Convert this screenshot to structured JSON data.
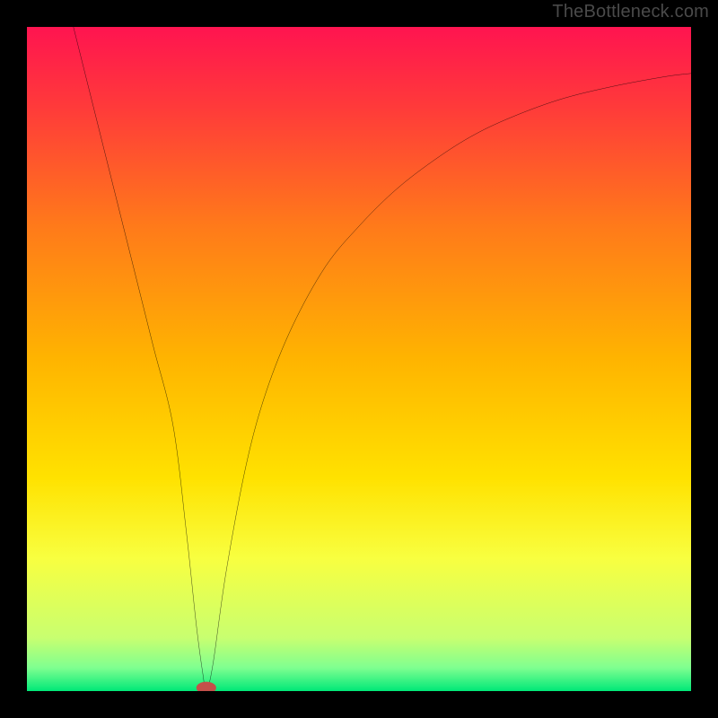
{
  "watermark": "TheBottleneck.com",
  "chart_data": {
    "type": "line",
    "title": "",
    "xlabel": "",
    "ylabel": "",
    "xlim": [
      0,
      100
    ],
    "ylim": [
      0,
      100
    ],
    "gradient_stops": [
      {
        "offset": 0.0,
        "color": "#ff1450"
      },
      {
        "offset": 0.12,
        "color": "#ff3a3a"
      },
      {
        "offset": 0.3,
        "color": "#ff7a1a"
      },
      {
        "offset": 0.5,
        "color": "#ffb400"
      },
      {
        "offset": 0.68,
        "color": "#ffe200"
      },
      {
        "offset": 0.8,
        "color": "#f8ff40"
      },
      {
        "offset": 0.92,
        "color": "#c8ff70"
      },
      {
        "offset": 0.965,
        "color": "#7fff90"
      },
      {
        "offset": 1.0,
        "color": "#00e878"
      }
    ],
    "series": [
      {
        "name": "bottleneck-curve",
        "color": "#000000",
        "x": [
          7.0,
          10,
          13,
          16,
          19,
          22,
          24,
          25.5,
          26.5,
          27.0,
          28,
          30,
          33,
          36,
          40,
          45,
          50,
          55,
          60,
          66,
          72,
          80,
          88,
          96,
          100
        ],
        "values": [
          100,
          88,
          76,
          64,
          52,
          40,
          24,
          10,
          2.5,
          0,
          4,
          18,
          34,
          45,
          55,
          64,
          70,
          75,
          79,
          83,
          86,
          89,
          91,
          92.5,
          93
        ]
      }
    ],
    "marker": {
      "name": "min-marker",
      "x": 27.0,
      "y": 0.5,
      "rx": 1.5,
      "ry": 0.9,
      "color": "#c4504a"
    }
  }
}
